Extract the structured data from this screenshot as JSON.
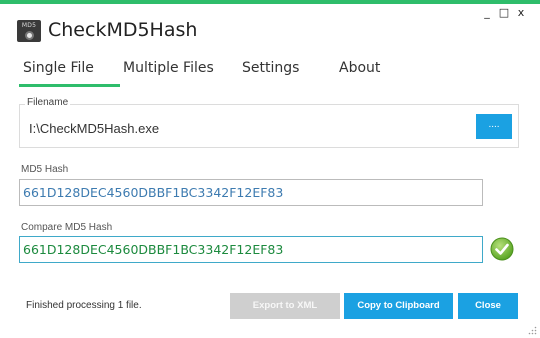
{
  "window": {
    "title": "CheckMD5Hash",
    "icon_label": "MD5",
    "minimize": "_",
    "maximize": "□",
    "close": "x"
  },
  "tabs": [
    {
      "label": "Single File",
      "active": true
    },
    {
      "label": "Multiple Files",
      "active": false
    },
    {
      "label": "Settings",
      "active": false
    },
    {
      "label": "About",
      "active": false
    }
  ],
  "filename": {
    "legend": "Filename",
    "value": "I:\\CheckMD5Hash.exe",
    "browse_label": "...."
  },
  "md5": {
    "label": "MD5 Hash",
    "value": "661D128DEC4560DBBF1BC3342F12EF83"
  },
  "compare": {
    "label": "Compare MD5 Hash",
    "value": "661D128DEC4560DBBF1BC3342F12EF83",
    "match_icon": "checkmark-icon"
  },
  "footer": {
    "status": "Finished processing 1 file.",
    "export_label": "Export to XML",
    "copy_label": "Copy to Clipboard",
    "close_label": "Close"
  },
  "colors": {
    "accent": "#2ebd6b",
    "button_blue": "#1ba1e2",
    "hash_text": "#3d7bb0",
    "match_text": "#1c8a3e"
  }
}
